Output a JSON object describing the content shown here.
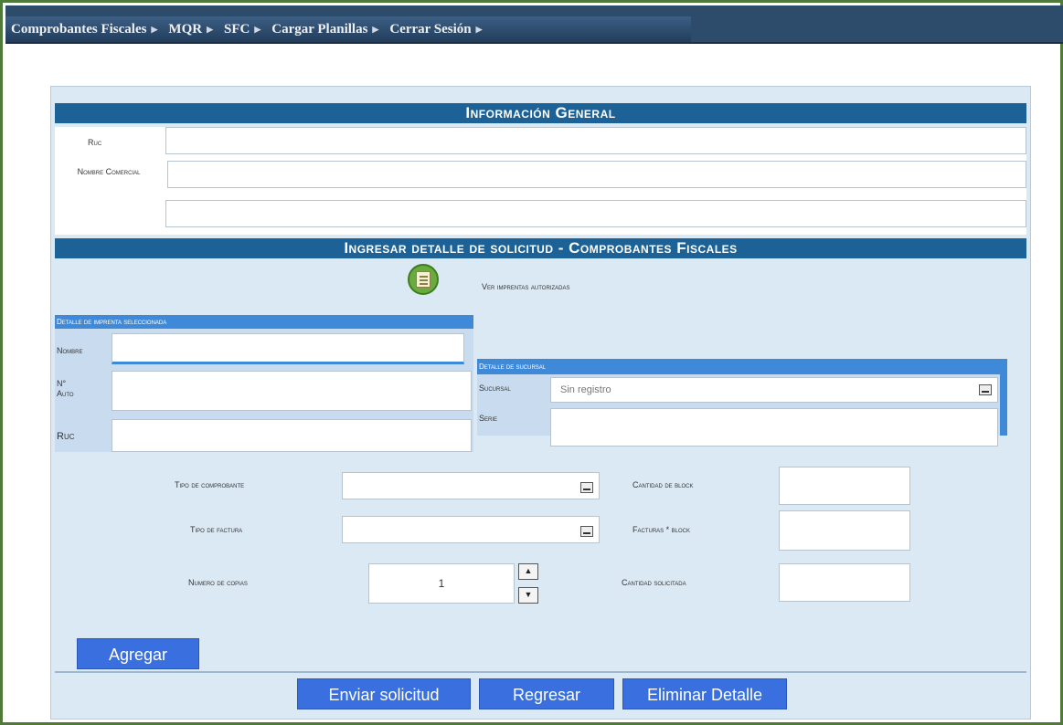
{
  "nav": {
    "items": [
      "Comprobantes Fiscales",
      "MQR",
      "SFC",
      "Cargar Planillas",
      "Cerrar Sesión"
    ]
  },
  "general": {
    "title": "Información General",
    "ruc_label": "Ruc",
    "nombre_label": "Nombre Comercial"
  },
  "detalle": {
    "title": "Ingresar detalle de solicitud - Comprobantes Fiscales",
    "ver_label": "Ver imprentas autorizadas"
  },
  "imprenta": {
    "header": "Detalle de imprenta seleccionada",
    "nombre_label": "Nombre",
    "auto_label": "N° Auto",
    "ruc_label": "Ruc"
  },
  "sucursal": {
    "header": "Detalle de sucursal",
    "sucursal_label": "Sucursal",
    "sucursal_value": "Sin registro",
    "serie_label": "Serie"
  },
  "form": {
    "tipo_comprobante_label": "Tipo de comprobante",
    "tipo_factura_label": "Tipo de factura",
    "numero_copias_label": "Numero de copias",
    "numero_copias_value": "1",
    "cantidad_block_label": "Cantidad de block",
    "facturas_block_label": "Facturas * block",
    "cantidad_solicitada_label": "Cantidad solicitada"
  },
  "buttons": {
    "agregar": "Agregar",
    "enviar": "Enviar solicitud",
    "regresar": "Regresar",
    "eliminar": "Eliminar Detalle"
  },
  "colors": {
    "section_bar": "#1d6296",
    "button": "#3a6fe0",
    "nav": "#2d4b6a"
  }
}
